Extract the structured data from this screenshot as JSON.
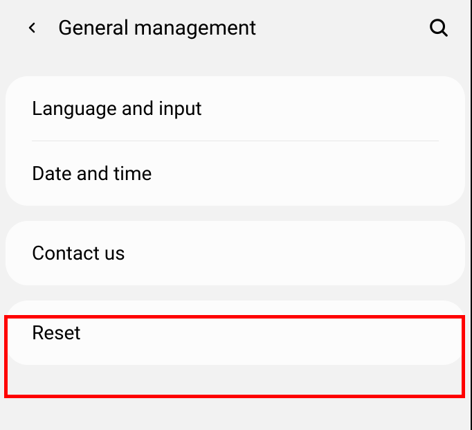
{
  "header": {
    "title": "General management"
  },
  "groups": [
    {
      "items": [
        {
          "label": "Language and input"
        },
        {
          "label": "Date and time"
        }
      ]
    },
    {
      "items": [
        {
          "label": "Contact us"
        }
      ]
    },
    {
      "items": [
        {
          "label": "Reset"
        }
      ]
    }
  ]
}
